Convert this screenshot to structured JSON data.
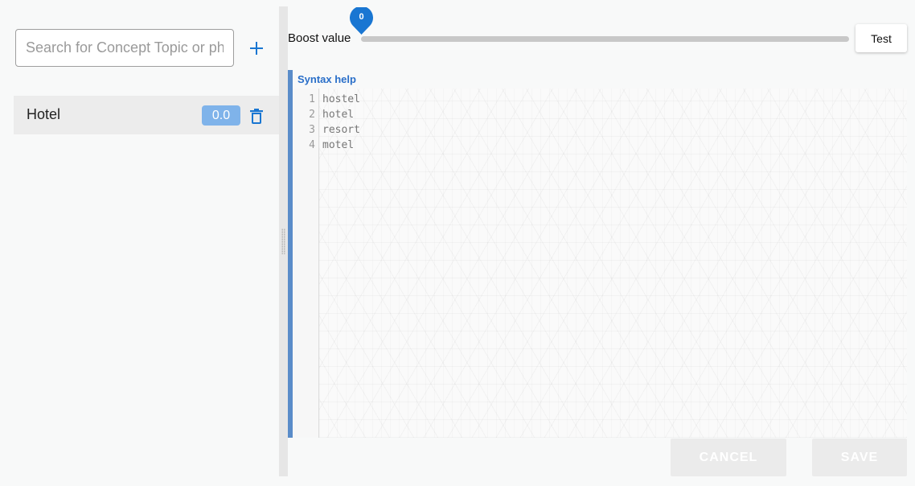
{
  "search": {
    "placeholder": "Search for Concept Topic or phrase"
  },
  "concepts": [
    {
      "label": "Hotel",
      "boost": "0.0"
    }
  ],
  "boost": {
    "label": "Boost value",
    "value": "0",
    "fraction": 0
  },
  "toolbar": {
    "test_label": "Test"
  },
  "editor": {
    "help_label": "Syntax help",
    "line_numbers": [
      "1",
      "2",
      "3",
      "4"
    ],
    "lines": [
      "hostel",
      "hotel",
      "resort",
      "motel"
    ]
  },
  "actions": {
    "cancel_label": "CANCEL",
    "save_label": "SAVE"
  },
  "colors": {
    "accent": "#1976d2",
    "badge": "#7fb3ea",
    "editor_accent": "#5a8cc9",
    "help_link": "#2a6fc9"
  },
  "icons": {
    "add": "plus-icon",
    "delete": "trash-icon",
    "slider_thumb": "map-pin-icon"
  }
}
